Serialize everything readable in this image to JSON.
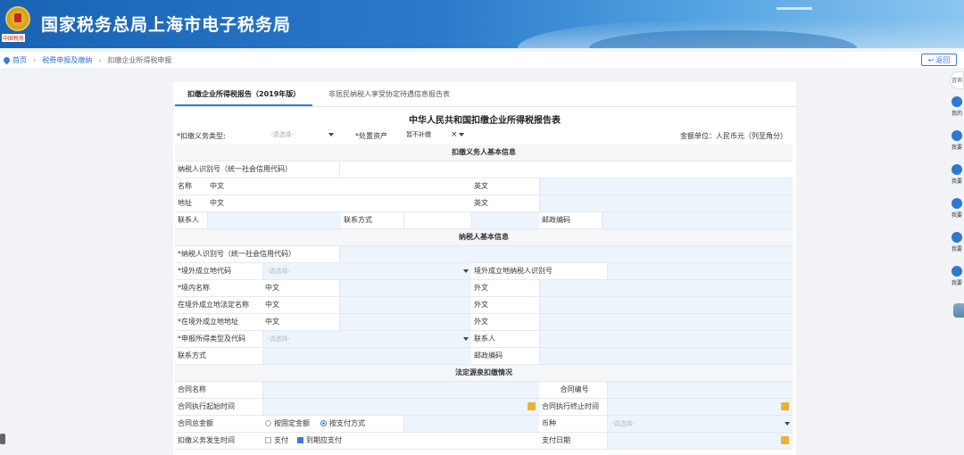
{
  "banner": {
    "title": "国家税务总局上海市电子税务局",
    "emblem_text": "中国税务"
  },
  "breadcrumb": {
    "home": "首页",
    "level1": "税费申报及缴纳",
    "level2": "扣缴企业所得税申报"
  },
  "back_label": "返回",
  "tabs": [
    {
      "label": "扣缴企业所得税报告（2019年版）"
    },
    {
      "label": "非居民纳税人享受协定待遇信息报告表"
    }
  ],
  "form_title": "中华人民共和国扣缴企业所得税报告表",
  "topline": {
    "obligation_type_label": "*扣缴义务类型:",
    "obligation_type_placeholder": "-请选择-",
    "asset_disposal_label": "*处置资产",
    "asset_disposal_value": "暂不补缴",
    "amount_unit": "金额单位：人民币元（列至角分）"
  },
  "sections": {
    "withholder": "扣缴义务人基本信息",
    "taxpayer": "纳税人基本信息",
    "source": "法定源泉扣缴情况"
  },
  "withholder": {
    "taxid_label": "纳税人识别号（统一社会信用代码）",
    "name_label": "名称",
    "name_cn": "中文",
    "name_en": "英文",
    "addr_label": "地址",
    "addr_cn": "中文",
    "addr_en": "英文",
    "contact_label": "联系人",
    "phone_label": "联系方式",
    "postcode_label": "邮政编码"
  },
  "taxpayer": {
    "taxid_label": "*纳税人识别号（统一社会信用代码）",
    "country_label": "*境外成立地代码",
    "country_placeholder": "-请选择-",
    "foreign_taxid_label": "境外成立地纳税人识别号",
    "domestic_name_label": "*境内名称",
    "domestic_name_cn": "中文",
    "domestic_name_foreign": "外文",
    "legal_name_label": "在境外成立地法定名称",
    "legal_name_cn": "中文",
    "legal_name_foreign": "外文",
    "address_label": "*在境外成立地地址",
    "address_cn": "中文",
    "address_foreign": "外文",
    "income_type_label": "*申报所得类型及代码",
    "income_type_placeholder": "-请选择-",
    "contact_label": "联系人",
    "phone_label": "联系方式",
    "postcode_label": "邮政编码"
  },
  "source": {
    "contract_name_label": "合同名称",
    "contract_no_label": "合同编号",
    "start_label": "合同执行起始时间",
    "end_label": "合同执行终止时间",
    "total_label": "合同总金额",
    "radio_fixed": "按固定金额",
    "radio_payment": "按支付方式",
    "currency_label": "币种",
    "currency_placeholder": "-请选择-",
    "occur_label": "扣缴义务发生时间",
    "chk_pay": "支付",
    "chk_due": "到期应支付",
    "pay_date_label": "支付日期"
  },
  "side": [
    {
      "label": "我的"
    },
    {
      "label": "我要"
    },
    {
      "label": "我要"
    },
    {
      "label": "我要"
    },
    {
      "label": "我要"
    },
    {
      "label": "我要"
    }
  ],
  "side_top": "咨询"
}
